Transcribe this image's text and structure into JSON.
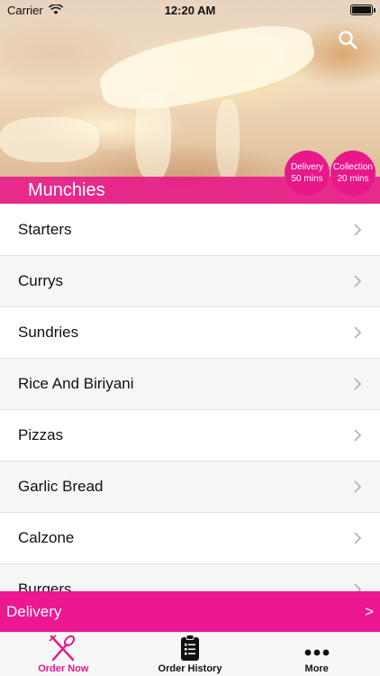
{
  "status_bar": {
    "carrier": "Carrier",
    "time": "12:20 AM"
  },
  "header": {
    "restaurant_name": "Munchies",
    "search_icon": "search-icon",
    "delivery_pill": {
      "label": "Delivery",
      "time": "50 mins"
    },
    "collection_pill": {
      "label": "Collection",
      "time": "20 mins"
    }
  },
  "menu": {
    "items": [
      {
        "label": "Starters"
      },
      {
        "label": "Currys"
      },
      {
        "label": "Sundries"
      },
      {
        "label": "Rice And Biriyani"
      },
      {
        "label": "Pizzas"
      },
      {
        "label": "Garlic Bread"
      },
      {
        "label": "Calzone"
      },
      {
        "label": "Burgers"
      }
    ]
  },
  "delivery_bar": {
    "label": "Delivery",
    "arrow": ">"
  },
  "tabs": [
    {
      "label": "Order Now",
      "icon": "fork-knife-icon",
      "active": true
    },
    {
      "label": "Order History",
      "icon": "clipboard-icon",
      "active": false
    },
    {
      "label": "More",
      "icon": "more-dots-icon",
      "active": false
    }
  ],
  "colors": {
    "accent": "#e8178a"
  }
}
